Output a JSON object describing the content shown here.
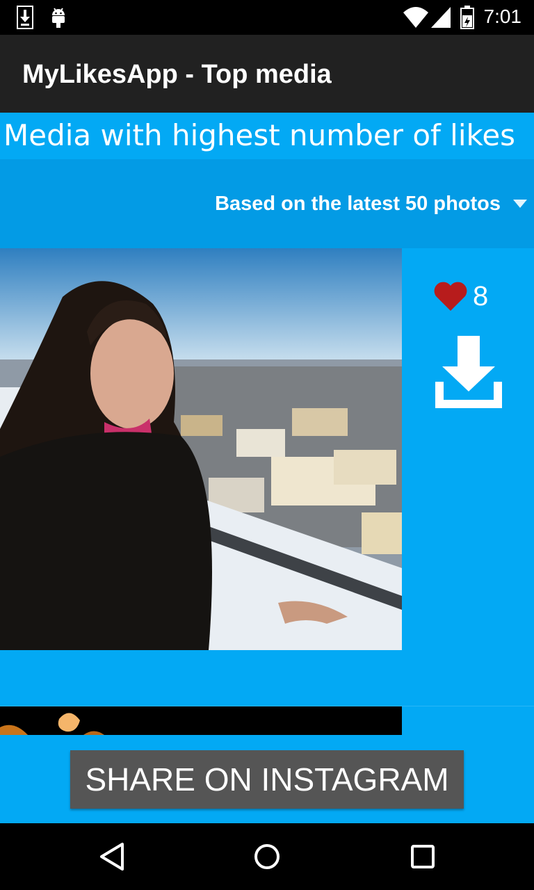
{
  "status_bar": {
    "time": "7:01",
    "icons": [
      "download-notification-icon",
      "android-icon",
      "wifi-icon",
      "signal-icon",
      "battery-icon"
    ]
  },
  "action_bar": {
    "title": "MyLikesApp - Top media"
  },
  "header": {
    "text": "Media with highest number of likes"
  },
  "spinner": {
    "selected": "Based on the latest 50 photos"
  },
  "media": [
    {
      "likes": "8",
      "like_icon": "heart-icon",
      "download_icon": "download-icon"
    }
  ],
  "share_button": {
    "label": "SHARE ON INSTAGRAM"
  },
  "nav_bar": {
    "icons": [
      "back-icon",
      "home-icon",
      "recents-icon"
    ]
  },
  "colors": {
    "accent": "#03a9f4",
    "spinner_bg": "#039be5",
    "action_bar": "#212121",
    "heart": "#b71c1c",
    "button": "#555555"
  }
}
